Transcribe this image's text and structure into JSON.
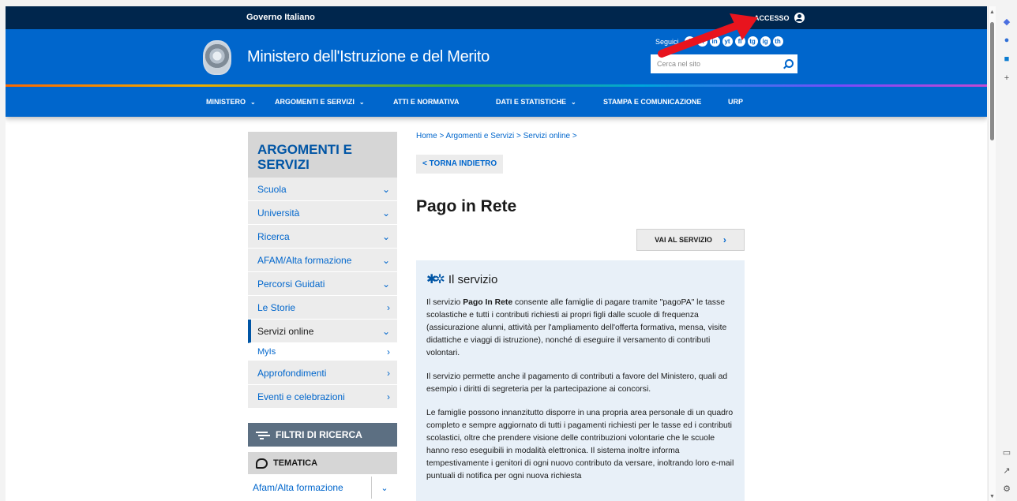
{
  "topbar": {
    "gov_label": "Governo Italiano",
    "access_label": "ACCESSO"
  },
  "header": {
    "title": "Ministero dell'Istruzione e del Merito",
    "follow_label": "Seguici",
    "social": [
      "f",
      "X",
      "in",
      "yt",
      "fl",
      "tg",
      "ig",
      "th"
    ],
    "search_placeholder": "Cerca nel sito"
  },
  "nav": [
    {
      "label": "MINISTERO",
      "chevron": "⌄"
    },
    {
      "label": "ARGOMENTI E SERVIZI",
      "chevron": "⌄"
    },
    {
      "label": "ATTI E NORMATIVA",
      "chevron": ""
    },
    {
      "label": "DATI E STATISTICHE",
      "chevron": "⌄"
    },
    {
      "label": "STAMPA E COMUNICAZIONE",
      "chevron": ""
    },
    {
      "label": "URP",
      "chevron": ""
    }
  ],
  "sidebar": {
    "title": "ARGOMENTI E SERVIZI",
    "items": [
      {
        "label": "Scuola",
        "arrow": "⌄"
      },
      {
        "label": "Università",
        "arrow": "⌄"
      },
      {
        "label": "Ricerca",
        "arrow": "⌄"
      },
      {
        "label": "AFAM/Alta formazione",
        "arrow": "⌄"
      },
      {
        "label": "Percorsi Guidati",
        "arrow": "⌄"
      },
      {
        "label": "Le Storie",
        "arrow": "›"
      },
      {
        "label": "Servizi online",
        "arrow": "⌄"
      },
      {
        "label": "MyIs",
        "arrow": "›"
      },
      {
        "label": "Approfondimenti",
        "arrow": "›"
      },
      {
        "label": "Eventi e celebrazioni",
        "arrow": "›"
      }
    ],
    "filters_label": "FILTRI DI RICERCA",
    "tematica_label": "TEMATICA",
    "filter_value": "Afam/Alta formazione"
  },
  "main": {
    "breadcrumb": "Home > Argomenti e Servizi > Servizi online >",
    "back_label": "< TORNA INDIETRO",
    "title": "Pago in Rete",
    "service_button": "VAI AL SERVIZIO",
    "section_title": "Il servizio",
    "p1_pre": "Il servizio ",
    "p1_bold": "Pago In Rete",
    "p1_post": " consente alle famiglie di pagare tramite \"pagoPA\" le tasse scolastiche e tutti i contributi richiesti ai propri figli dalle scuole di frequenza (assicurazione alunni, attività per l'ampliamento dell'offerta formativa, mensa, visite didattiche e viaggi di istruzione), nonché di eseguire il versamento di contributi volontari.",
    "p2": "Il servizio permette anche il pagamento di contributi a favore del Ministero, quali ad esempio i diritti di segreteria per la partecipazione ai concorsi.",
    "p3": "Le famiglie possono innanzitutto disporre in una propria area personale di un quadro completo e sempre aggiornato di tutti i pagamenti richiesti per le tasse ed i contributi scolastici, oltre che prendere visione delle contribuzioni volontarie che le scuole hanno reso eseguibili in modalità elettronica. Il sistema inoltre informa tempestivamente i genitori di ogni nuovo contributo da versare, inoltrando loro e-mail puntuali di notifica per ogni nuova richiesta"
  },
  "colors": {
    "topbar": "#00264d",
    "brand_blue": "#0066cc",
    "arrow_red": "#e8141e",
    "infobox": "#e8f0f8"
  }
}
